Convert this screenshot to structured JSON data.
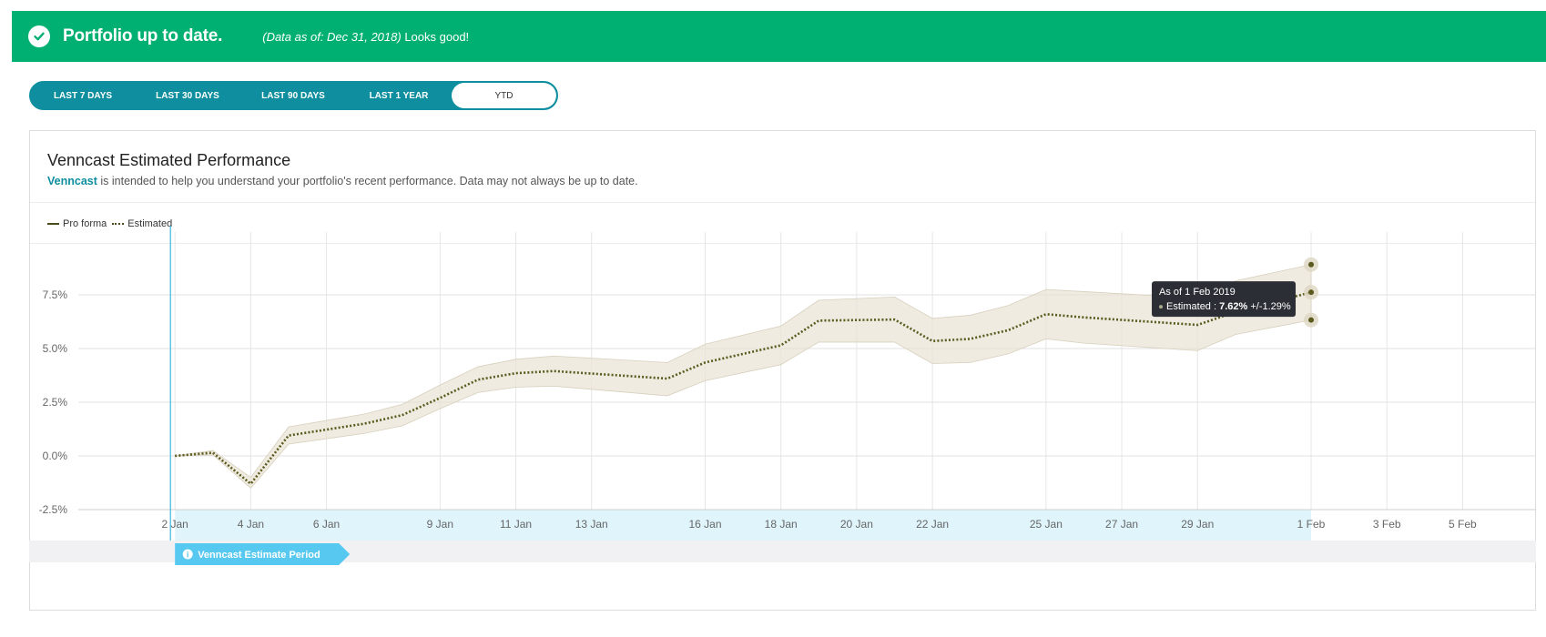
{
  "banner": {
    "title": "Portfolio up to date.",
    "note_italic": "(Data as of: Dec 31, 2018)",
    "note_text": " Looks good!",
    "color": "#00b073"
  },
  "range_tabs": [
    {
      "label": "LAST 7 DAYS",
      "active": false
    },
    {
      "label": "LAST 30 DAYS",
      "active": false
    },
    {
      "label": "LAST 90 DAYS",
      "active": false
    },
    {
      "label": "LAST 1 YEAR",
      "active": false
    },
    {
      "label": "YTD",
      "active": true
    }
  ],
  "card": {
    "title": "Venncast Estimated Performance",
    "subtitle_link": "Venncast",
    "subtitle_text": " is intended to help you understand your portfolio's recent performance. Data may not always be up to date."
  },
  "legend": [
    {
      "label": "Pro forma",
      "style": "solid",
      "color": "#4a4a1a"
    },
    {
      "label": "Estimated",
      "style": "dotted",
      "color": "#4a4a1a"
    }
  ],
  "tooltip": {
    "title": "As of 1 Feb 2019",
    "label": "Estimated : ",
    "value": "7.62%",
    "band": " +/-1.29%"
  },
  "period_badge": "Venncast Estimate Period",
  "chart_data": {
    "type": "line",
    "ylim": [
      -2.5,
      10
    ],
    "y_ticks": [
      -2.5,
      0,
      2.5,
      5,
      7.5
    ],
    "y_tick_labels": [
      "-2.5%",
      "0.0%",
      "2.5%",
      "5.0%",
      "7.5%"
    ],
    "x_ticks": [
      "2019-01-02",
      "2019-01-04",
      "2019-01-06",
      "2019-01-09",
      "2019-01-11",
      "2019-01-13",
      "2019-01-16",
      "2019-01-18",
      "2019-01-20",
      "2019-01-22",
      "2019-01-25",
      "2019-01-27",
      "2019-01-29",
      "2019-02-01",
      "2019-02-03",
      "2019-02-05"
    ],
    "x_tick_labels": [
      "2 Jan",
      "4 Jan",
      "6 Jan",
      "9 Jan",
      "11 Jan",
      "13 Jan",
      "16 Jan",
      "18 Jan",
      "20 Jan",
      "22 Jan",
      "25 Jan",
      "27 Jan",
      "29 Jan",
      "1 Feb",
      "3 Feb",
      "5 Feb"
    ],
    "x_range": [
      "2018-12-31",
      "2019-02-06"
    ],
    "estimate_period": [
      "2019-01-02",
      "2019-02-01"
    ],
    "grid": true,
    "legend_position": "top-left",
    "band_color": "#e8e2d3",
    "line_color": "#5a5a1e",
    "period_color": "#dff4fb",
    "badge_color": "#57c8ef",
    "series": [
      {
        "name": "Estimated",
        "style": "dotted",
        "points": [
          {
            "x": "2019-01-02",
            "y": 0.0,
            "lo": 0.0,
            "hi": 0.0
          },
          {
            "x": "2019-01-03",
            "y": 0.15,
            "lo": 0.05,
            "hi": 0.25
          },
          {
            "x": "2019-01-04",
            "y": -1.3,
            "lo": -1.5,
            "hi": -1.0
          },
          {
            "x": "2019-01-05",
            "y": 0.95,
            "lo": 0.55,
            "hi": 1.35
          },
          {
            "x": "2019-01-07",
            "y": 1.5,
            "lo": 1.05,
            "hi": 1.95
          },
          {
            "x": "2019-01-08",
            "y": 1.9,
            "lo": 1.4,
            "hi": 2.4
          },
          {
            "x": "2019-01-09",
            "y": 2.7,
            "lo": 2.2,
            "hi": 3.3
          },
          {
            "x": "2019-01-10",
            "y": 3.55,
            "lo": 2.95,
            "hi": 4.15
          },
          {
            "x": "2019-01-11",
            "y": 3.85,
            "lo": 3.2,
            "hi": 4.5
          },
          {
            "x": "2019-01-12",
            "y": 3.95,
            "lo": 3.25,
            "hi": 4.65
          },
          {
            "x": "2019-01-15",
            "y": 3.6,
            "lo": 2.8,
            "hi": 4.35
          },
          {
            "x": "2019-01-16",
            "y": 4.35,
            "lo": 3.5,
            "hi": 5.2
          },
          {
            "x": "2019-01-18",
            "y": 5.15,
            "lo": 4.25,
            "hi": 6.05
          },
          {
            "x": "2019-01-19",
            "y": 6.3,
            "lo": 5.3,
            "hi": 7.25
          },
          {
            "x": "2019-01-21",
            "y": 6.35,
            "lo": 5.3,
            "hi": 7.4
          },
          {
            "x": "2019-01-22",
            "y": 5.35,
            "lo": 4.3,
            "hi": 6.4
          },
          {
            "x": "2019-01-23",
            "y": 5.45,
            "lo": 4.35,
            "hi": 6.55
          },
          {
            "x": "2019-01-24",
            "y": 5.85,
            "lo": 4.75,
            "hi": 7.0
          },
          {
            "x": "2019-01-25",
            "y": 6.6,
            "lo": 5.45,
            "hi": 7.75
          },
          {
            "x": "2019-01-26",
            "y": 6.45,
            "lo": 5.25,
            "hi": 7.65
          },
          {
            "x": "2019-01-29",
            "y": 6.1,
            "lo": 4.9,
            "hi": 7.35
          },
          {
            "x": "2019-01-30",
            "y": 6.7,
            "lo": 5.65,
            "hi": 8.15
          },
          {
            "x": "2019-02-01",
            "y": 7.62,
            "lo": 6.33,
            "hi": 8.91
          }
        ]
      }
    ]
  }
}
